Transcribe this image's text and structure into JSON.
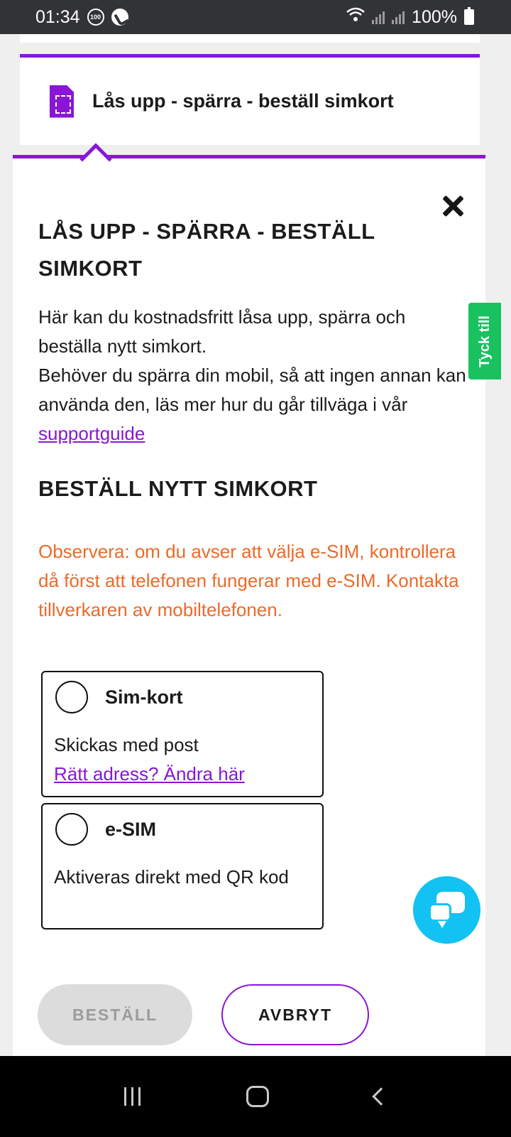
{
  "status_bar": {
    "time": "01:34",
    "badge": "100",
    "battery": "100%"
  },
  "tab": {
    "title": "Lås upp - spärra - beställ simkort"
  },
  "panel": {
    "heading": "LÅS UPP - SPÄRRA - BESTÄLL SIMKORT",
    "intro_line1": "Här kan du kostnadsfritt låsa upp, spärra och beställa nytt simkort.",
    "intro_line2": "Behöver du spärra din mobil, så att ingen annan kan använda den, läs mer hur du går tillväga i vår",
    "support_link": "supportguide",
    "order_heading": "BESTÄLL NYTT SIMKORT",
    "warning": "Observera: om du avser att välja e-SIM, kontrollera då först att telefonen fungerar med e-SIM. Kontakta tillverkaren av mobiltelefonen."
  },
  "options": [
    {
      "title": "Sim-kort",
      "description": "Skickas med post",
      "link": "Rätt adress? Ändra här"
    },
    {
      "title": "e-SIM",
      "description": "Aktiveras direkt med QR kod"
    }
  ],
  "buttons": {
    "order": "BESTÄLL",
    "cancel": "AVBRYT"
  },
  "feedback_tab": "Tyck till",
  "colors": {
    "accent": "#8a15d6",
    "warning": "#ec6a2a",
    "feedback": "#17c25f",
    "chat": "#12c2f2"
  }
}
